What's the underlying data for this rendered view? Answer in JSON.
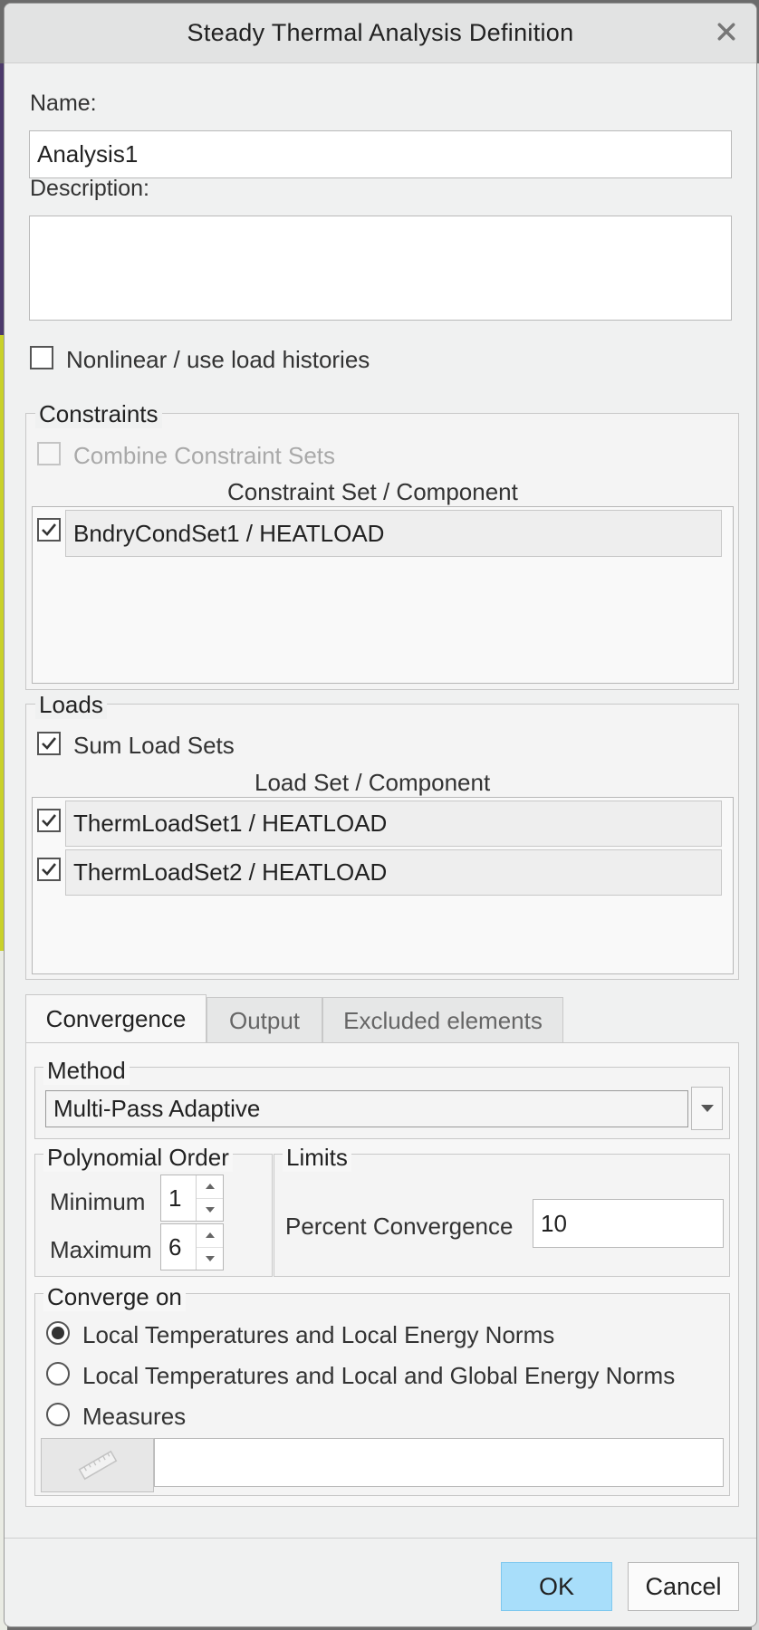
{
  "dialog": {
    "title": "Steady Thermal Analysis Definition",
    "close_icon": "close-icon"
  },
  "name": {
    "label": "Name:",
    "value": "Analysis1"
  },
  "description": {
    "label": "Description:",
    "value": ""
  },
  "nonlinear": {
    "label": "Nonlinear / use load histories",
    "checked": false
  },
  "constraints": {
    "legend": "Constraints",
    "combine_label": "Combine Constraint Sets",
    "combine_checked": false,
    "column_header": "Constraint Set / Component",
    "rows": [
      {
        "label": "BndryCondSet1 / HEATLOAD",
        "checked": true
      }
    ]
  },
  "loads": {
    "legend": "Loads",
    "sum_label": "Sum Load Sets",
    "sum_checked": true,
    "column_header": "Load Set / Component",
    "rows": [
      {
        "label": "ThermLoadSet1 / HEATLOAD",
        "checked": true
      },
      {
        "label": "ThermLoadSet2 / HEATLOAD",
        "checked": true
      }
    ]
  },
  "tabs": [
    {
      "label": "Convergence",
      "active": true
    },
    {
      "label": "Output",
      "active": false
    },
    {
      "label": "Excluded elements",
      "active": false
    }
  ],
  "method": {
    "legend": "Method",
    "selected": "Multi-Pass Adaptive"
  },
  "polynomial_order": {
    "legend": "Polynomial Order",
    "minimum_label": "Minimum",
    "minimum_value": "1",
    "maximum_label": "Maximum",
    "maximum_value": "6"
  },
  "limits": {
    "legend": "Limits",
    "percent_label": "Percent Convergence",
    "percent_value": "10"
  },
  "converge_on": {
    "legend": "Converge on",
    "options": [
      {
        "label": "Local Temperatures and Local Energy Norms",
        "selected": true
      },
      {
        "label": "Local Temperatures and Local and Global Energy Norms",
        "selected": false
      },
      {
        "label": "Measures",
        "selected": false
      }
    ],
    "measure_icon": "ruler-icon",
    "measure_value": ""
  },
  "buttons": {
    "ok": "OK",
    "cancel": "Cancel"
  },
  "colors": {
    "primary_button": "#a8defa",
    "dialog_bg": "#f0f1f1"
  }
}
